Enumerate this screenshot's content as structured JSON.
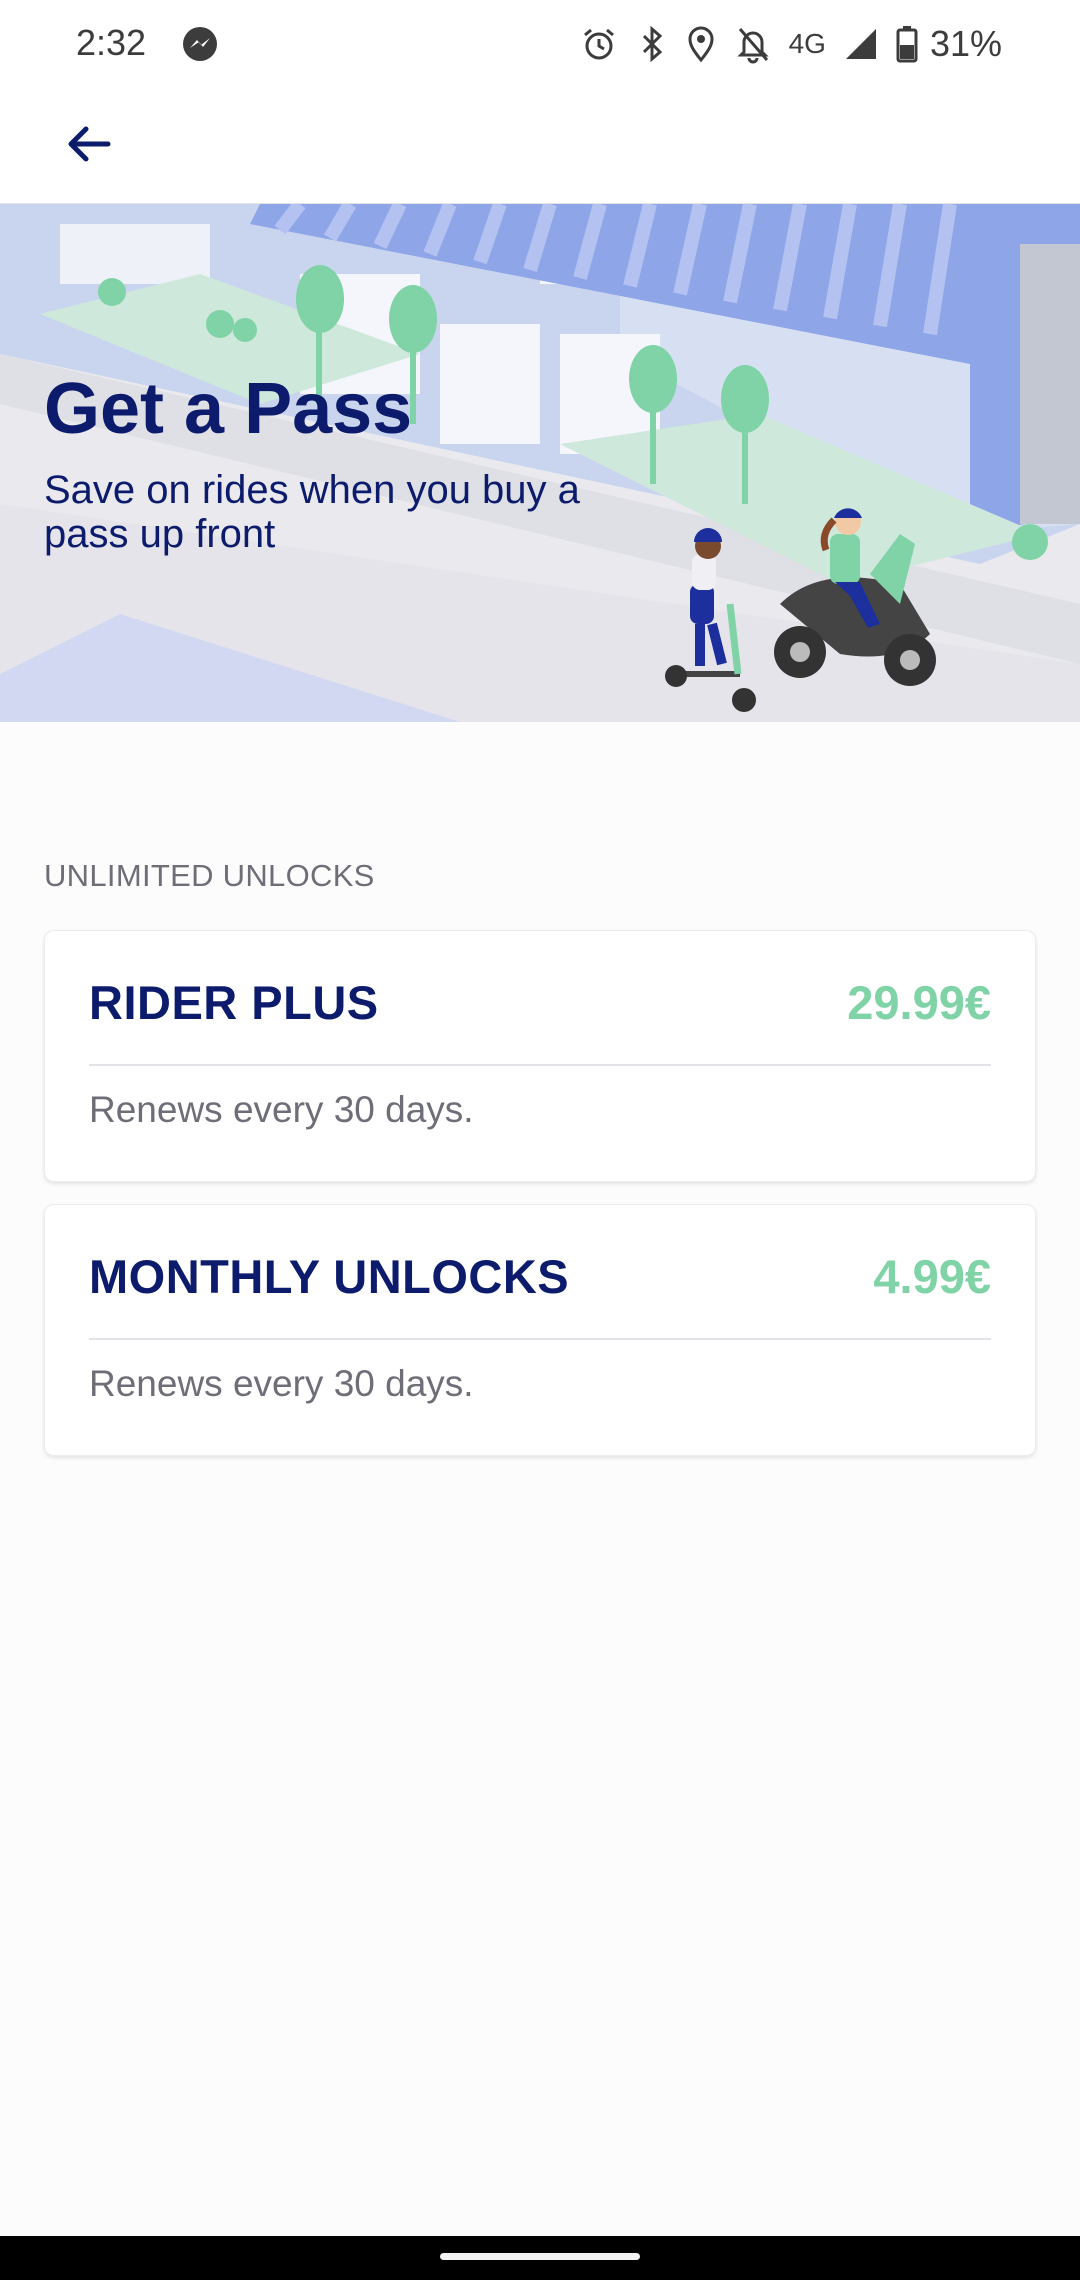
{
  "status_bar": {
    "time": "2:32",
    "notification_icon": "messenger-icon",
    "icons": [
      "alarm-icon",
      "bluetooth-icon",
      "location-icon",
      "notifications-off-icon"
    ],
    "network": "4G",
    "battery": "31%"
  },
  "app_bar": {
    "back_icon": "arrow-back-icon"
  },
  "hero": {
    "title": "Get a Pass",
    "subtitle": "Save on rides when you buy a pass up front"
  },
  "section": {
    "label": "UNLIMITED UNLOCKS"
  },
  "passes": [
    {
      "name": "RIDER PLUS",
      "price": "29.99€",
      "renewal": "Renews every 30 days."
    },
    {
      "name": "MONTHLY UNLOCKS",
      "price": "4.99€",
      "renewal": "Renews every 30 days."
    }
  ],
  "colors": {
    "brand_navy": "#0c1b6c",
    "price_green": "#7fd3a6",
    "muted_text": "#6e6e78"
  }
}
